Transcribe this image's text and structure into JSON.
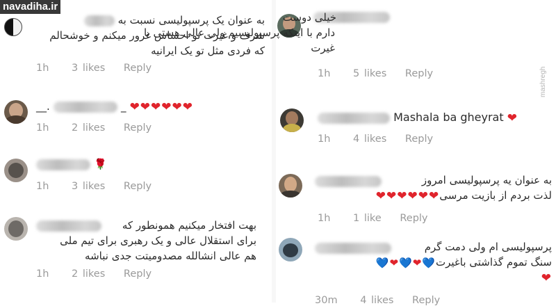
{
  "watermark": {
    "top": "navadiha.ir",
    "side": "mashregh"
  },
  "left": [
    {
      "lines": [
        "به عنوان یک پرسپولیسی نسبت به",
        "شرف و غیرت تو احساس غرور میکنم و خوشحالم",
        "که فردی مثل تو یک ایرانیه"
      ],
      "time": "1h",
      "likes": "3 likes",
      "reply": "Reply"
    },
    {
      "username_visible": "__.",
      "hearts": "❤❤❤❤❤❤",
      "time": "1h",
      "likes": "2 likes",
      "reply": "Reply"
    },
    {
      "emoji": "🌹",
      "time": "1h",
      "likes": "3 likes",
      "reply": "Reply"
    },
    {
      "lines": [
        "بهت افتخار میکنیم همونطور که",
        "برای استقلال عالی و یک  رهبری برای تیم ملی",
        "هم عالی انشالله مصدومیتت جدی نباشه"
      ],
      "time": "1h",
      "likes": "2 likes",
      "reply": "Reply"
    }
  ],
  "right": [
    {
      "lines": [
        "خیلی دوست",
        "دارم با اینکه پرسپولیسیم ولی عالی هستی با",
        "غیرت"
      ],
      "time": "1h",
      "likes": "5 likes",
      "reply": "Reply"
    },
    {
      "text": "Mashala ba gheyrat",
      "heart": "❤",
      "time": "1h",
      "likes": "4 likes",
      "reply": "Reply"
    },
    {
      "lines": [
        "به عنوان یه پرسپولیسی امروز",
        "لذت بردم از بازیت مرسی"
      ],
      "hearts": "❤❤❤❤❤❤",
      "time": "1h",
      "likes": "1 like",
      "reply": "Reply"
    },
    {
      "lines": [
        "پرسپولیسی ام ولی دمت گرم",
        "سنگ تموم گذاشتی باغیرت"
      ],
      "hearts_mixed": "💙❤💙❤💙",
      "heart_end": "❤",
      "time": "30m",
      "likes": "4 likes",
      "reply": "Reply"
    }
  ],
  "colors": {
    "heart": "#e0242c",
    "blue_heart": "#2a7de1",
    "meta": "#9a9a9a",
    "text": "#2b2b2b"
  }
}
